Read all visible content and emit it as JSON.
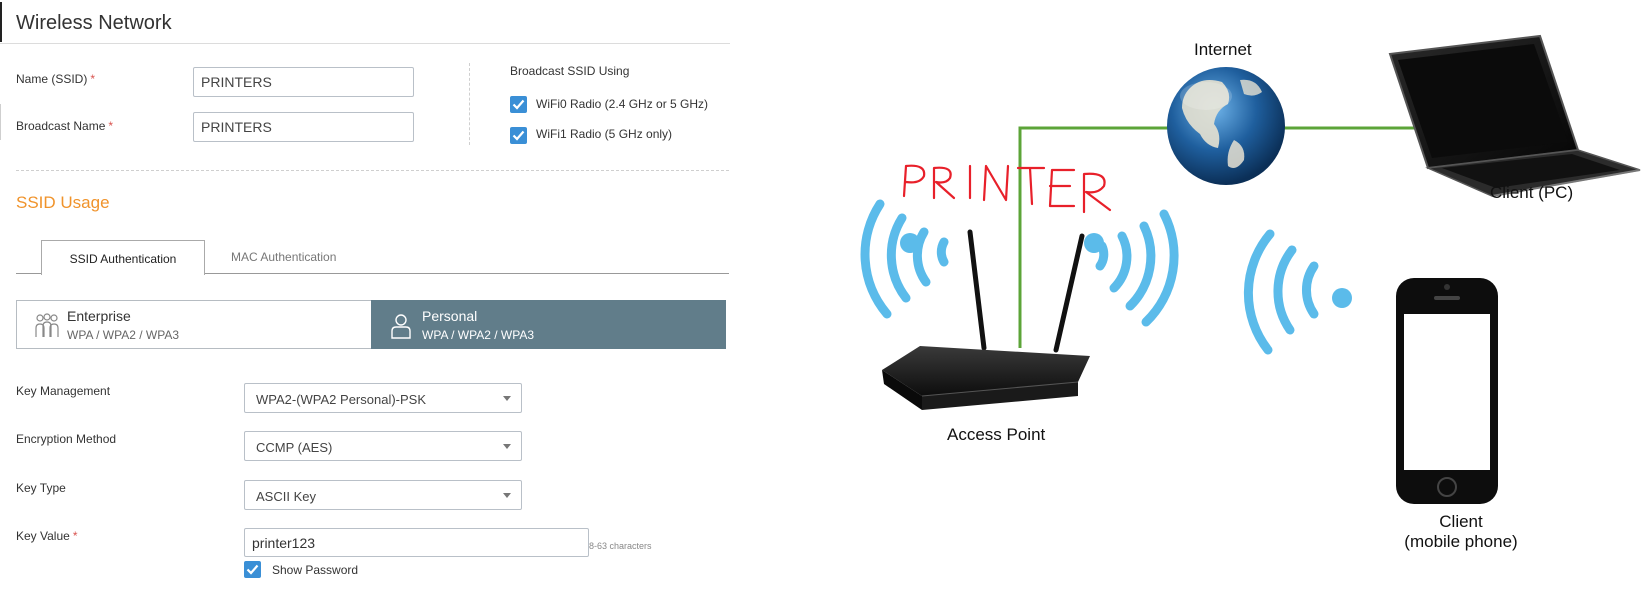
{
  "header": {
    "title": "Wireless Network"
  },
  "form": {
    "ssid_label": "Name (SSID)",
    "ssid_value": "PRINTERS",
    "broadcast_label": "Broadcast Name",
    "broadcast_value": "PRINTERS",
    "required_marker": "*"
  },
  "broadcast": {
    "title": "Broadcast SSID Using",
    "options": [
      {
        "label": "WiFi0 Radio (2.4 GHz or 5 GHz)",
        "checked": true
      },
      {
        "label": "WiFi1 Radio (5 GHz only)",
        "checked": true
      }
    ]
  },
  "usage": {
    "title": "SSID Usage",
    "tabs": [
      {
        "label": "SSID Authentication",
        "active": true
      },
      {
        "label": "MAC Authentication",
        "active": false
      }
    ],
    "modes": [
      {
        "name": "Enterprise",
        "sub": "WPA / WPA2 / WPA3",
        "selected": false,
        "icon": "group-icon"
      },
      {
        "name": "Personal",
        "sub": "WPA / WPA2 / WPA3",
        "selected": true,
        "icon": "person-icon"
      }
    ]
  },
  "security": {
    "key_management": {
      "label": "Key Management",
      "value": "WPA2-(WPA2 Personal)-PSK"
    },
    "encryption": {
      "label": "Encryption Method",
      "value": "CCMP (AES)"
    },
    "key_type": {
      "label": "Key Type",
      "value": "ASCII Key"
    },
    "key_value": {
      "label": "Key Value",
      "value": "printer123",
      "hint": "8-63 characters"
    },
    "show_password": {
      "label": "Show Password",
      "checked": true
    }
  },
  "diagram": {
    "internet": "Internet",
    "client_pc": "Client (PC)",
    "access_point": "Access Point",
    "client_mobile_line1": "Client",
    "client_mobile_line2": "(mobile phone)",
    "handwritten": "PRINTER"
  },
  "colors": {
    "accent_orange": "#f0932b",
    "checkbox_blue": "#3a8fd6",
    "personal_selected": "#617d8a",
    "wifi_waves": "#5bbbea",
    "link_green": "#5ca438",
    "handwriting_red": "#e8202a"
  }
}
